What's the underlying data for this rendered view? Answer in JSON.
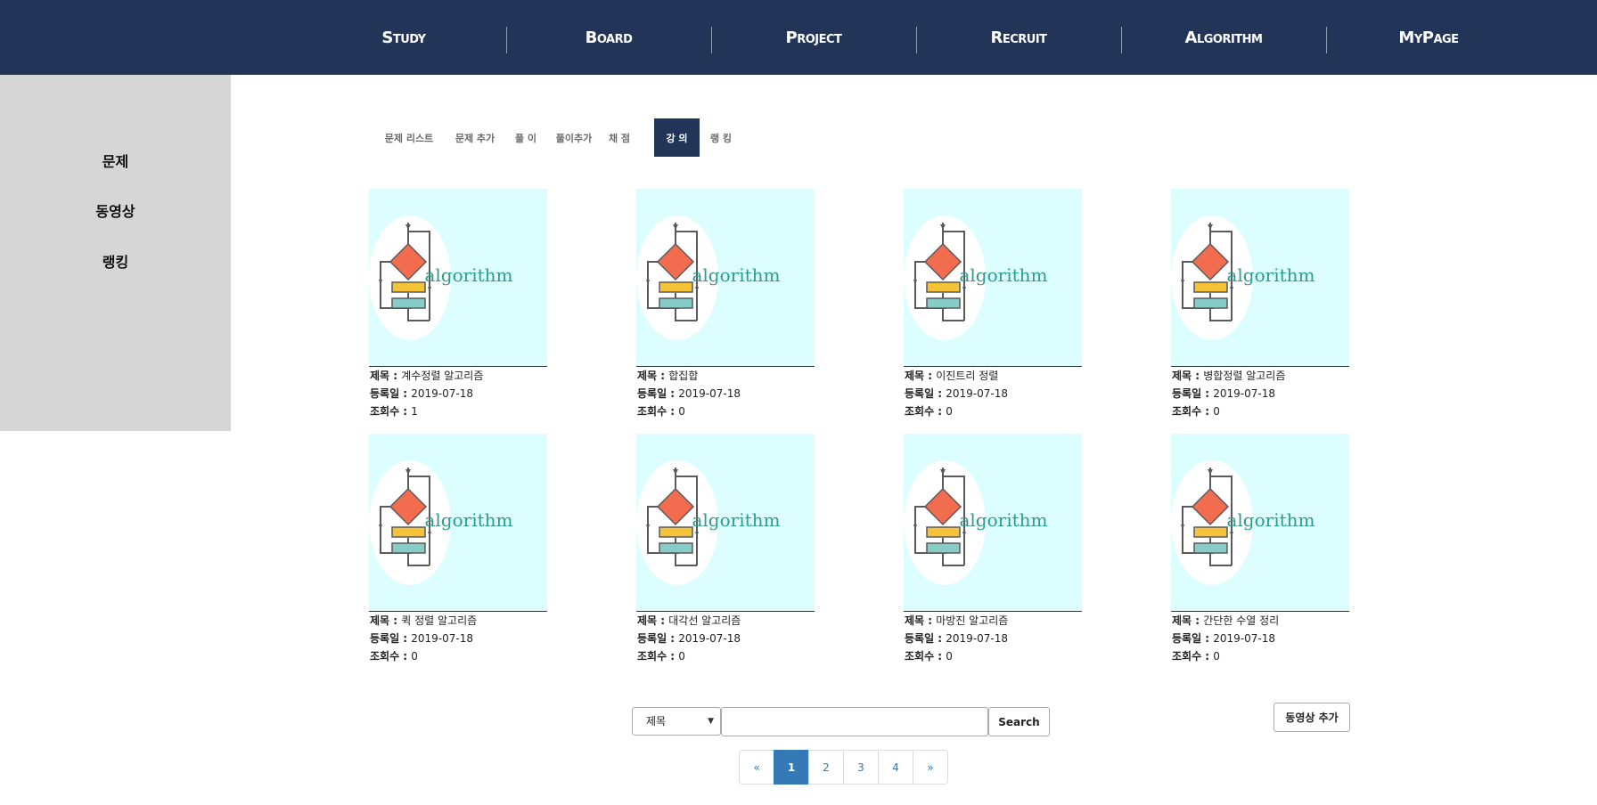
{
  "topnav": {
    "items": [
      {
        "label": "Study"
      },
      {
        "label": "Board"
      },
      {
        "label": "Project"
      },
      {
        "label": "Recruit"
      },
      {
        "label": "Algorithm"
      },
      {
        "label": "MyPage"
      }
    ]
  },
  "sidebar": {
    "items": [
      {
        "label": "문제"
      },
      {
        "label": "동영상"
      },
      {
        "label": "랭킹"
      }
    ]
  },
  "subtabs": {
    "items": [
      {
        "label": "문제 리스트"
      },
      {
        "label": "문제 추가"
      },
      {
        "label": "풀 이"
      },
      {
        "label": "풀이추가"
      },
      {
        "label": "채 점"
      },
      {
        "label": "강 의"
      },
      {
        "label": "랭 킹"
      }
    ],
    "active": "강 의"
  },
  "lectures": {
    "thumb_text": "algorithm",
    "items": [
      {
        "title_label": "제목 : ",
        "title": "계수정렬 알고리즘",
        "date_label": "등록일 : ",
        "date": "2019-07-18",
        "views_label": "조회수 : ",
        "views": "1"
      },
      {
        "title_label": "제목 : ",
        "title": "합집합",
        "date_label": "등록일 : ",
        "date": "2019-07-18",
        "views_label": "조회수 : ",
        "views": "0"
      },
      {
        "title_label": "제목 : ",
        "title": "이진트리 정렬",
        "date_label": "등록일 : ",
        "date": "2019-07-18",
        "views_label": "조회수 : ",
        "views": "0"
      },
      {
        "title_label": "제목 : ",
        "title": "병합정렬 알고리즘",
        "date_label": "등록일 : ",
        "date": "2019-07-18",
        "views_label": "조회수 : ",
        "views": "0"
      },
      {
        "title_label": "제목 : ",
        "title": "퀵 정렬 알고리즘",
        "date_label": "등록일 : ",
        "date": "2019-07-18",
        "views_label": "조회수 : ",
        "views": "0"
      },
      {
        "title_label": "제목 : ",
        "title": "대각선 알고리즘",
        "date_label": "등록일 : ",
        "date": "2019-07-18",
        "views_label": "조회수 : ",
        "views": "0"
      },
      {
        "title_label": "제목 : ",
        "title": "마방진 알고리즘",
        "date_label": "등록일 : ",
        "date": "2019-07-18",
        "views_label": "조회수 : ",
        "views": "0"
      },
      {
        "title_label": "제목 : ",
        "title": "간단한 수열 정리",
        "date_label": "등록일 : ",
        "date": "2019-07-18",
        "views_label": "조회수 : ",
        "views": "0"
      }
    ]
  },
  "search": {
    "select_value": "제목",
    "input_value": "",
    "input_placeholder": "",
    "button_label": "Search"
  },
  "add_video_label": "동영상 추가",
  "pagination": {
    "prev": "«",
    "pages": [
      "1",
      "2",
      "3",
      "4"
    ],
    "next": "»",
    "current": "1"
  },
  "colors": {
    "nav_bg": "#223558",
    "sidebar_bg": "#d6d6d6",
    "thumb_bg": "#dcfefe",
    "diamond": "#f26c4f",
    "bar_yellow": "#f5c338",
    "bar_teal": "#86cdc8",
    "algo_text": "#2a9d8f",
    "pager_active": "#337ab7"
  }
}
